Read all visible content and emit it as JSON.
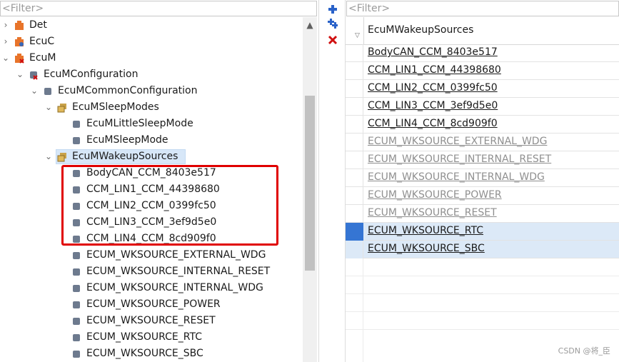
{
  "left_panel": {
    "filter_placeholder": "<Filter>",
    "tree": [
      {
        "label": "Det",
        "expanded": false,
        "icon": "module-icon"
      },
      {
        "label": "EcuC",
        "expanded": false,
        "icon": "module-icon"
      },
      {
        "label": "EcuM",
        "expanded": true,
        "icon": "module-icon"
      },
      {
        "label": "EcuMConfiguration",
        "expanded": true,
        "icon": "container-icon"
      },
      {
        "label": "EcuMCommonConfiguration",
        "expanded": true,
        "icon": "container-icon"
      },
      {
        "label": "EcuMSleepModes",
        "expanded": true,
        "icon": "folder-icon"
      },
      {
        "label": "EcuMLittleSleepMode",
        "icon": "param-icon"
      },
      {
        "label": "EcuMSleepMode",
        "icon": "param-icon"
      },
      {
        "label": "EcuMWakeupSources",
        "expanded": true,
        "selected": true,
        "icon": "folder-icon"
      },
      {
        "label": "BodyCAN_CCM_8403e517",
        "icon": "param-icon"
      },
      {
        "label": "CCM_LIN1_CCM_44398680",
        "icon": "param-icon"
      },
      {
        "label": "CCM_LIN2_CCM_0399fc50",
        "icon": "param-icon"
      },
      {
        "label": "CCM_LIN3_CCM_3ef9d5e0",
        "icon": "param-icon"
      },
      {
        "label": "CCM_LIN4_CCM_8cd909f0",
        "icon": "param-icon"
      },
      {
        "label": "ECUM_WKSOURCE_EXTERNAL_WDG",
        "icon": "param-icon"
      },
      {
        "label": "ECUM_WKSOURCE_INTERNAL_RESET",
        "icon": "param-icon"
      },
      {
        "label": "ECUM_WKSOURCE_INTERNAL_WDG",
        "icon": "param-icon"
      },
      {
        "label": "ECUM_WKSOURCE_POWER",
        "icon": "param-icon"
      },
      {
        "label": "ECUM_WKSOURCE_RESET",
        "icon": "param-icon"
      },
      {
        "label": "ECUM_WKSOURCE_RTC",
        "icon": "param-icon"
      },
      {
        "label": "ECUM_WKSOURCE_SBC",
        "icon": "param-icon"
      }
    ]
  },
  "toolbar": {
    "add_icon": "add-icon",
    "add_multiple_icon": "add-multiple-icon",
    "delete_icon": "delete-icon"
  },
  "right_panel": {
    "filter_placeholder": "<Filter>",
    "column_header": "EcuMWakeupSources",
    "rows": [
      {
        "value": "BodyCAN_CCM_8403e517",
        "state": "normal"
      },
      {
        "value": "CCM_LIN1_CCM_44398680",
        "state": "normal"
      },
      {
        "value": "CCM_LIN2_CCM_0399fc50",
        "state": "normal"
      },
      {
        "value": "CCM_LIN3_CCM_3ef9d5e0",
        "state": "normal"
      },
      {
        "value": "CCM_LIN4_CCM_8cd909f0",
        "state": "normal"
      },
      {
        "value": "ECUM_WKSOURCE_EXTERNAL_WDG",
        "state": "grey"
      },
      {
        "value": "ECUM_WKSOURCE_INTERNAL_RESET",
        "state": "grey"
      },
      {
        "value": "ECUM_WKSOURCE_INTERNAL_WDG",
        "state": "grey"
      },
      {
        "value": "ECUM_WKSOURCE_POWER",
        "state": "grey"
      },
      {
        "value": "ECUM_WKSOURCE_RESET",
        "state": "grey"
      },
      {
        "value": "ECUM_WKSOURCE_RTC",
        "state": "selected"
      },
      {
        "value": "ECUM_WKSOURCE_SBC",
        "state": "selected"
      }
    ]
  },
  "watermark": "CSDN @将_臣",
  "colors": {
    "highlight": "#e00000",
    "selection": "#3575d3"
  }
}
